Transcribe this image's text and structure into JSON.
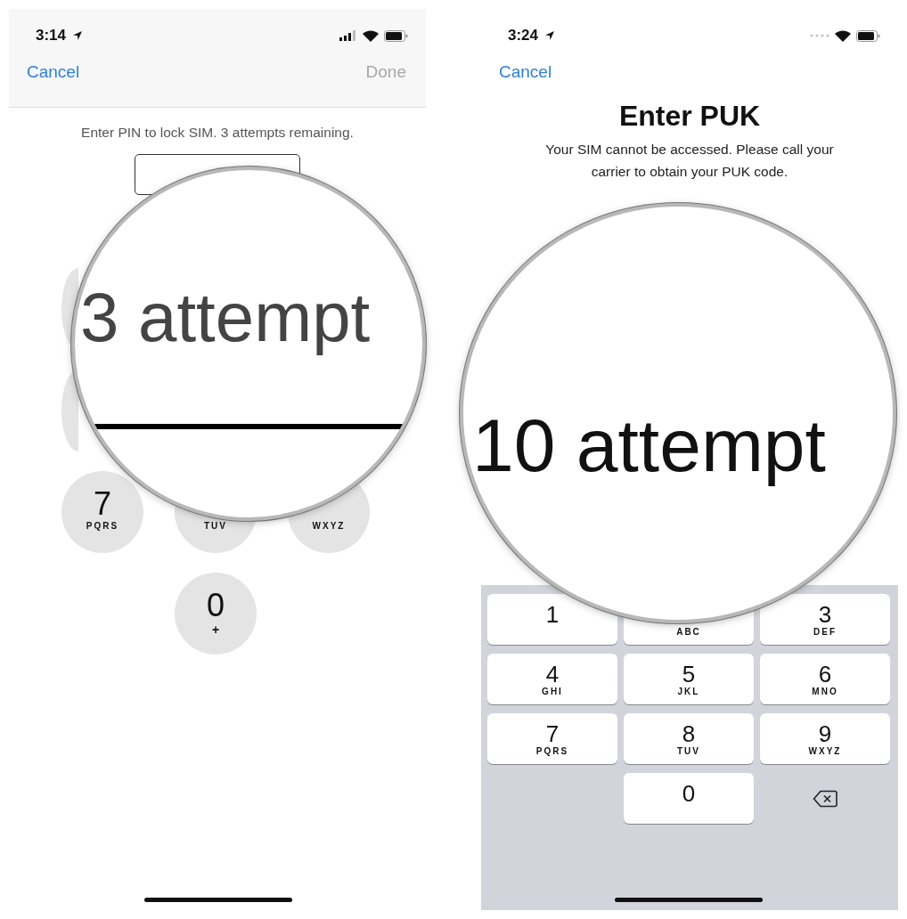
{
  "screens": [
    {
      "status_bar": {
        "time": "3:14",
        "no_service": false
      },
      "nav": {
        "cancel": "Cancel",
        "done": {
          "label": "Done",
          "disabled": true
        }
      },
      "message": "Enter PIN to lock SIM. 3 attempts remaining.",
      "pin_field": {
        "kind": "box"
      },
      "keypad": {
        "kind": "circles",
        "keys": [
          {
            "kind": "key"
          },
          {
            "kind": "hidden"
          },
          {
            "kind": "hidden"
          },
          {
            "kind": "key"
          },
          {
            "kind": "hidden"
          },
          {
            "kind": "hidden"
          },
          {
            "kind": "key",
            "digit": "7",
            "letters": "PQRS"
          },
          {
            "kind": "key",
            "letters": "TUV"
          },
          {
            "kind": "key",
            "letters": "WXYZ"
          },
          {
            "kind": "blank"
          },
          {
            "kind": "key",
            "digit": "0",
            "letters": "+"
          },
          {
            "kind": "blank"
          }
        ]
      },
      "magnifier": {
        "text": "3 attempt",
        "underline": true
      }
    },
    {
      "status_bar": {
        "time": "3:24",
        "no_service": true
      },
      "nav": {
        "cancel": "Cancel"
      },
      "title": "Enter PUK",
      "message": "Your SIM cannot be accessed. Please call your carrier to obtain your PUK code.",
      "keypad": {
        "kind": "keyboard",
        "keys": [
          {
            "kind": "key",
            "digit": "1"
          },
          {
            "kind": "key",
            "letters": "ABC"
          },
          {
            "kind": "key",
            "digit": "3",
            "letters": "DEF"
          },
          {
            "kind": "key",
            "digit": "4",
            "letters": "GHI"
          },
          {
            "kind": "key",
            "digit": "5",
            "letters": "JKL"
          },
          {
            "kind": "key",
            "digit": "6",
            "letters": "MNO"
          },
          {
            "kind": "key",
            "digit": "7",
            "letters": "PQRS"
          },
          {
            "kind": "key",
            "digit": "8",
            "letters": "TUV"
          },
          {
            "kind": "key",
            "digit": "9",
            "letters": "WXYZ"
          },
          {
            "kind": "blank"
          },
          {
            "kind": "key",
            "digit": "0"
          },
          {
            "kind": "delete"
          }
        ]
      },
      "magnifier": {
        "text": "10 attempt",
        "underline": false
      }
    }
  ]
}
